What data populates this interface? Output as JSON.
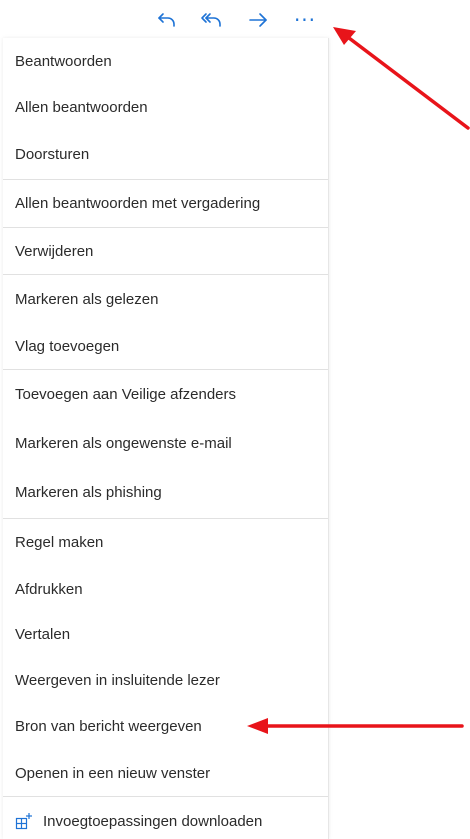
{
  "toolbar": {
    "reply_icon": "reply-icon",
    "reply_all_icon": "reply-all-icon",
    "forward_icon": "forward-arrow-icon",
    "more_glyph": "···"
  },
  "menu": {
    "groups": [
      {
        "items": [
          "Beantwoorden",
          "Allen beantwoorden",
          "Doorsturen"
        ]
      },
      {
        "items": [
          "Allen beantwoorden met vergadering"
        ]
      },
      {
        "items": [
          "Verwijderen"
        ]
      },
      {
        "items": [
          "Markeren als gelezen",
          "Vlag toevoegen"
        ]
      },
      {
        "items": [
          "Toevoegen aan Veilige afzenders",
          "Markeren als ongewenste e-mail",
          "Markeren als phishing"
        ]
      },
      {
        "items": [
          "Regel maken",
          "Afdrukken",
          "Vertalen",
          "Weergeven in insluitende lezer",
          "Bron van bericht weergeven",
          "Openen in een nieuw venster"
        ]
      },
      {
        "items": [
          "Invoegtoepassingen downloaden"
        ]
      }
    ]
  },
  "colors": {
    "accent": "#1e73d6",
    "annotation_arrow": "#e8141a"
  }
}
